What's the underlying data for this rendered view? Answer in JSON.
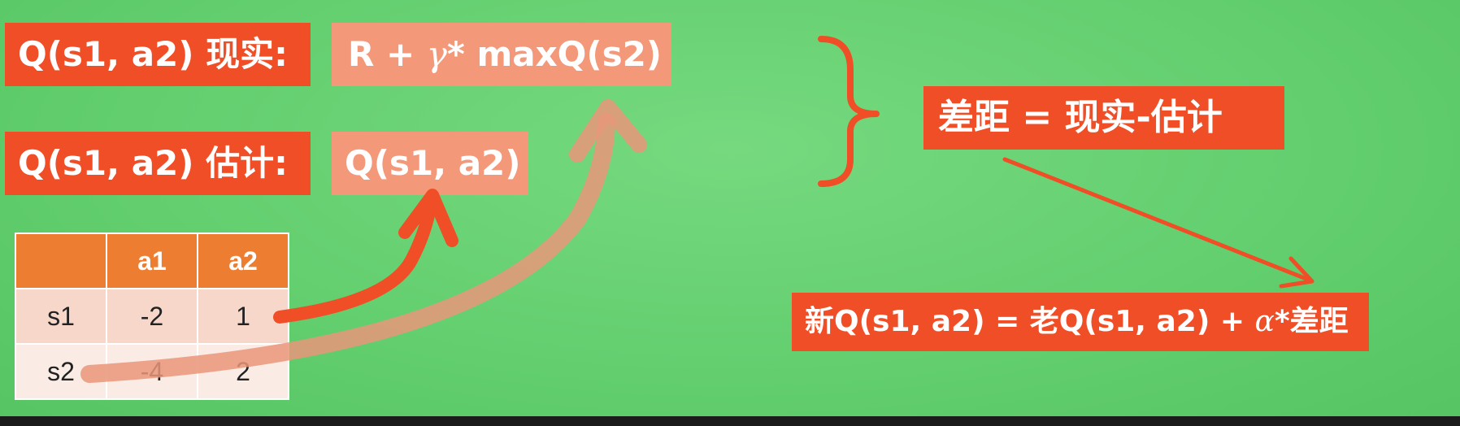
{
  "labels": {
    "real_label": "Q(s1, a2) 现实:",
    "real_value_a": "R + ",
    "real_value_gamma": "γ",
    "real_value_b": "* maxQ(s2)",
    "est_label": "Q(s1, a2) 估计:",
    "est_value": "Q(s1, a2)",
    "difference": "差距 = 现实-估计",
    "update_a": "新Q(s1, a2) = 老Q(s1, a2) + ",
    "update_alpha": "α",
    "update_b": "*差距"
  },
  "q_table": {
    "headers": [
      "",
      "a1",
      "a2"
    ],
    "rows": [
      {
        "state": "s1",
        "a1": "-2",
        "a2": "1"
      },
      {
        "state": "s2",
        "a1": "-4",
        "a2": "2"
      }
    ]
  },
  "colors": {
    "background": "#63cf6f",
    "dark_box": "#f04e26",
    "light_box": "#f4987a",
    "table_header": "#ed7d31",
    "arrow": "#f04e26",
    "faded_arrow": "#e9967a"
  }
}
